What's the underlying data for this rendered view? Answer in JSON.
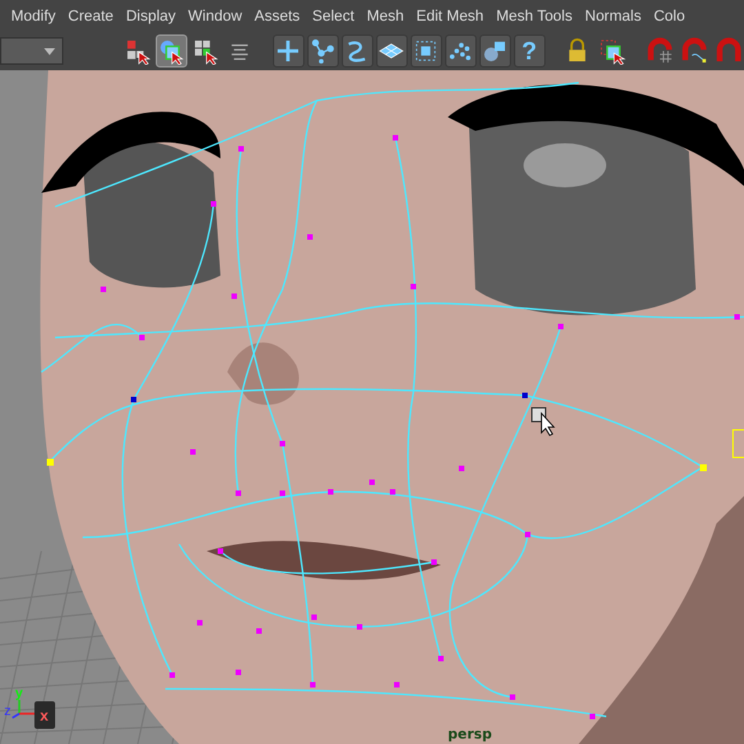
{
  "menu_bar": {
    "items": [
      {
        "label": "Modify"
      },
      {
        "label": "Create"
      },
      {
        "label": "Display"
      },
      {
        "label": "Window"
      },
      {
        "label": "Assets"
      },
      {
        "label": "Select"
      },
      {
        "label": "Mesh"
      },
      {
        "label": "Edit Mesh"
      },
      {
        "label": "Mesh Tools"
      },
      {
        "label": "Normals"
      },
      {
        "label": "Colo"
      }
    ]
  },
  "toolbar": {
    "items": [
      {
        "kind": "dropdown"
      },
      {
        "kind": "select-hierarchy",
        "pressed": false
      },
      {
        "kind": "select-object",
        "pressed": true
      },
      {
        "kind": "select-component",
        "pressed": false
      },
      {
        "kind": "lines",
        "pressed": false
      },
      {
        "kind": "move",
        "pressed": false
      },
      {
        "kind": "vertex",
        "pressed": false
      },
      {
        "kind": "edge",
        "pressed": false
      },
      {
        "kind": "face",
        "pressed": false
      },
      {
        "kind": "uv",
        "pressed": false
      },
      {
        "kind": "points",
        "pressed": false
      },
      {
        "kind": "multi",
        "pressed": false
      },
      {
        "kind": "help",
        "label": "?",
        "pressed": false
      },
      {
        "kind": "lock",
        "pressed": false
      },
      {
        "kind": "marquee",
        "pressed": false
      },
      {
        "kind": "snap-grid",
        "pressed": false
      },
      {
        "kind": "snap-curve",
        "pressed": false
      },
      {
        "kind": "snap-point",
        "pressed": false
      }
    ]
  },
  "viewport": {
    "axis_labels": [
      "y",
      "z",
      "x"
    ],
    "camera": "persp"
  }
}
